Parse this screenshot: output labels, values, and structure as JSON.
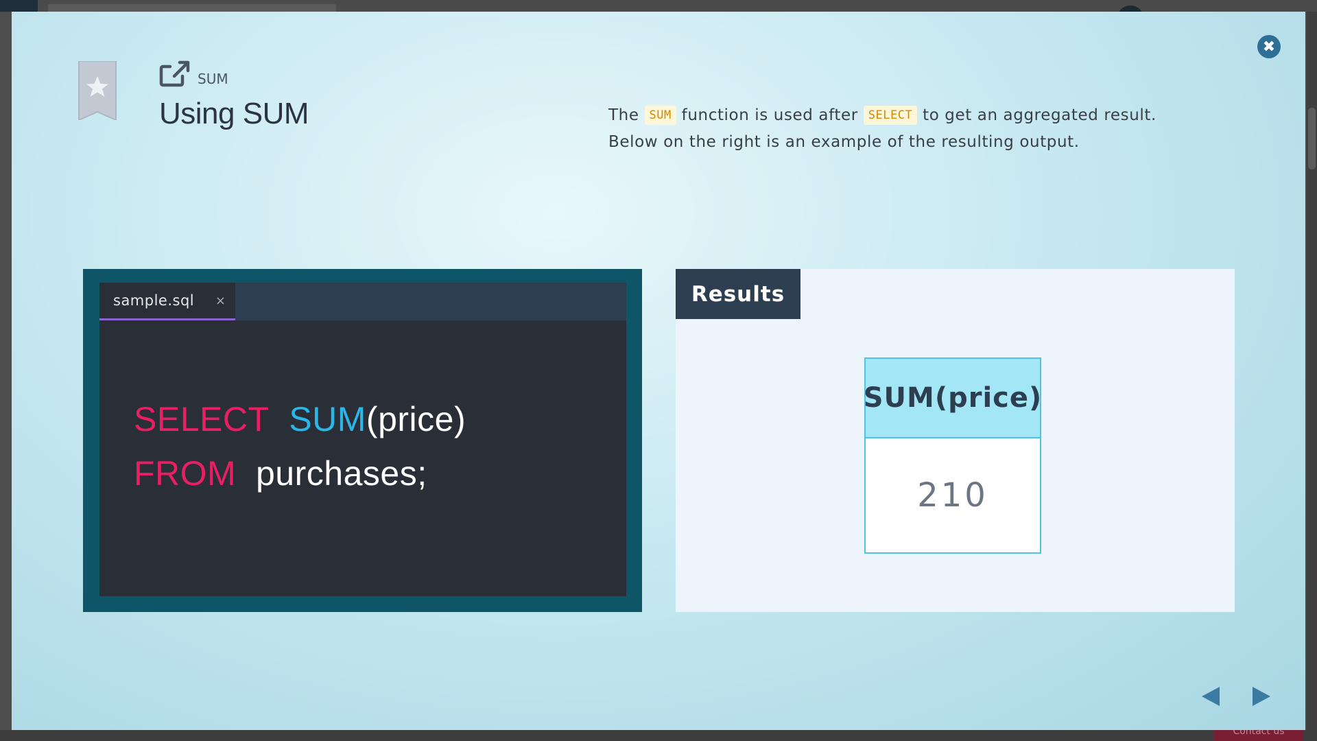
{
  "lesson": {
    "kicker": "SUM",
    "title": "Using SUM"
  },
  "description": {
    "part1": "The",
    "chip1": "SUM",
    "part2": "function is used after",
    "chip2": "SELECT",
    "part3": "to get an aggregated result.",
    "line2": "Below on the right is an example of the resulting output."
  },
  "editor": {
    "tab_name": "sample.sql",
    "tab_close": "×",
    "line1": {
      "keyword": "SELECT",
      "function": "SUM",
      "rest": "(price)"
    },
    "line2": {
      "keyword": "FROM",
      "rest": "purchases;"
    }
  },
  "results": {
    "tab_label": "Results",
    "column_header": "SUM(price)",
    "value": "210"
  },
  "modal": {
    "close_label": "✖"
  },
  "background": {
    "contact_label": "Contact us"
  },
  "colors": {
    "keyword": "#e91e63",
    "function": "#29b6e8",
    "chip_text": "#d08a0a",
    "accent_close": "#2f6f96",
    "nav_arrows": "#3d7aa3"
  },
  "icons": [
    "close-icon",
    "bookmark-star-icon",
    "external-link-icon",
    "prev-arrow-icon",
    "next-arrow-icon"
  ]
}
